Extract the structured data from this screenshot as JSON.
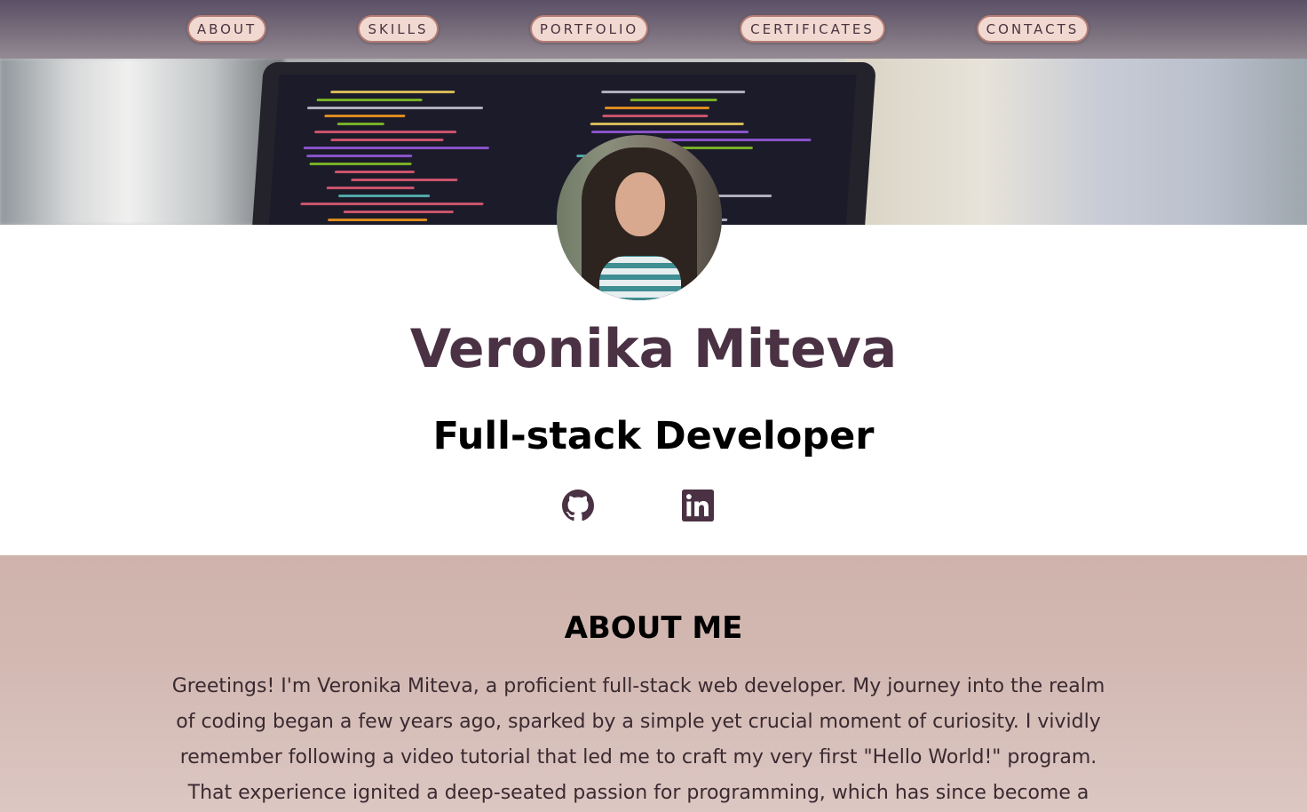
{
  "nav": {
    "items": [
      {
        "label": "ABOUT"
      },
      {
        "label": "SKILLS"
      },
      {
        "label": "PORTFOLIO"
      },
      {
        "label": "CERTIFICATES"
      },
      {
        "label": "CONTACTS"
      }
    ]
  },
  "profile": {
    "name": "Veronika Miteva",
    "role": "Full-stack Developer"
  },
  "social": {
    "github_icon": "github-icon",
    "linkedin_icon": "linkedin-icon"
  },
  "about": {
    "title": "ABOUT ME",
    "text": "Greetings! I'm Veronika Miteva, a proficient full-stack web developer. My journey into the realm of coding began a few years ago, sparked by a simple yet crucial moment of curiosity. I vividly remember following a video tutorial that led me to craft my very first \"Hello World!\" program. That experience ignited a deep-seated passion for programming, which has since become a"
  },
  "colors": {
    "accent": "#4a3143",
    "nav_button_bg": "#f1d9d2",
    "nav_button_border": "#b37c74",
    "about_bg": "#d3b8b2"
  }
}
